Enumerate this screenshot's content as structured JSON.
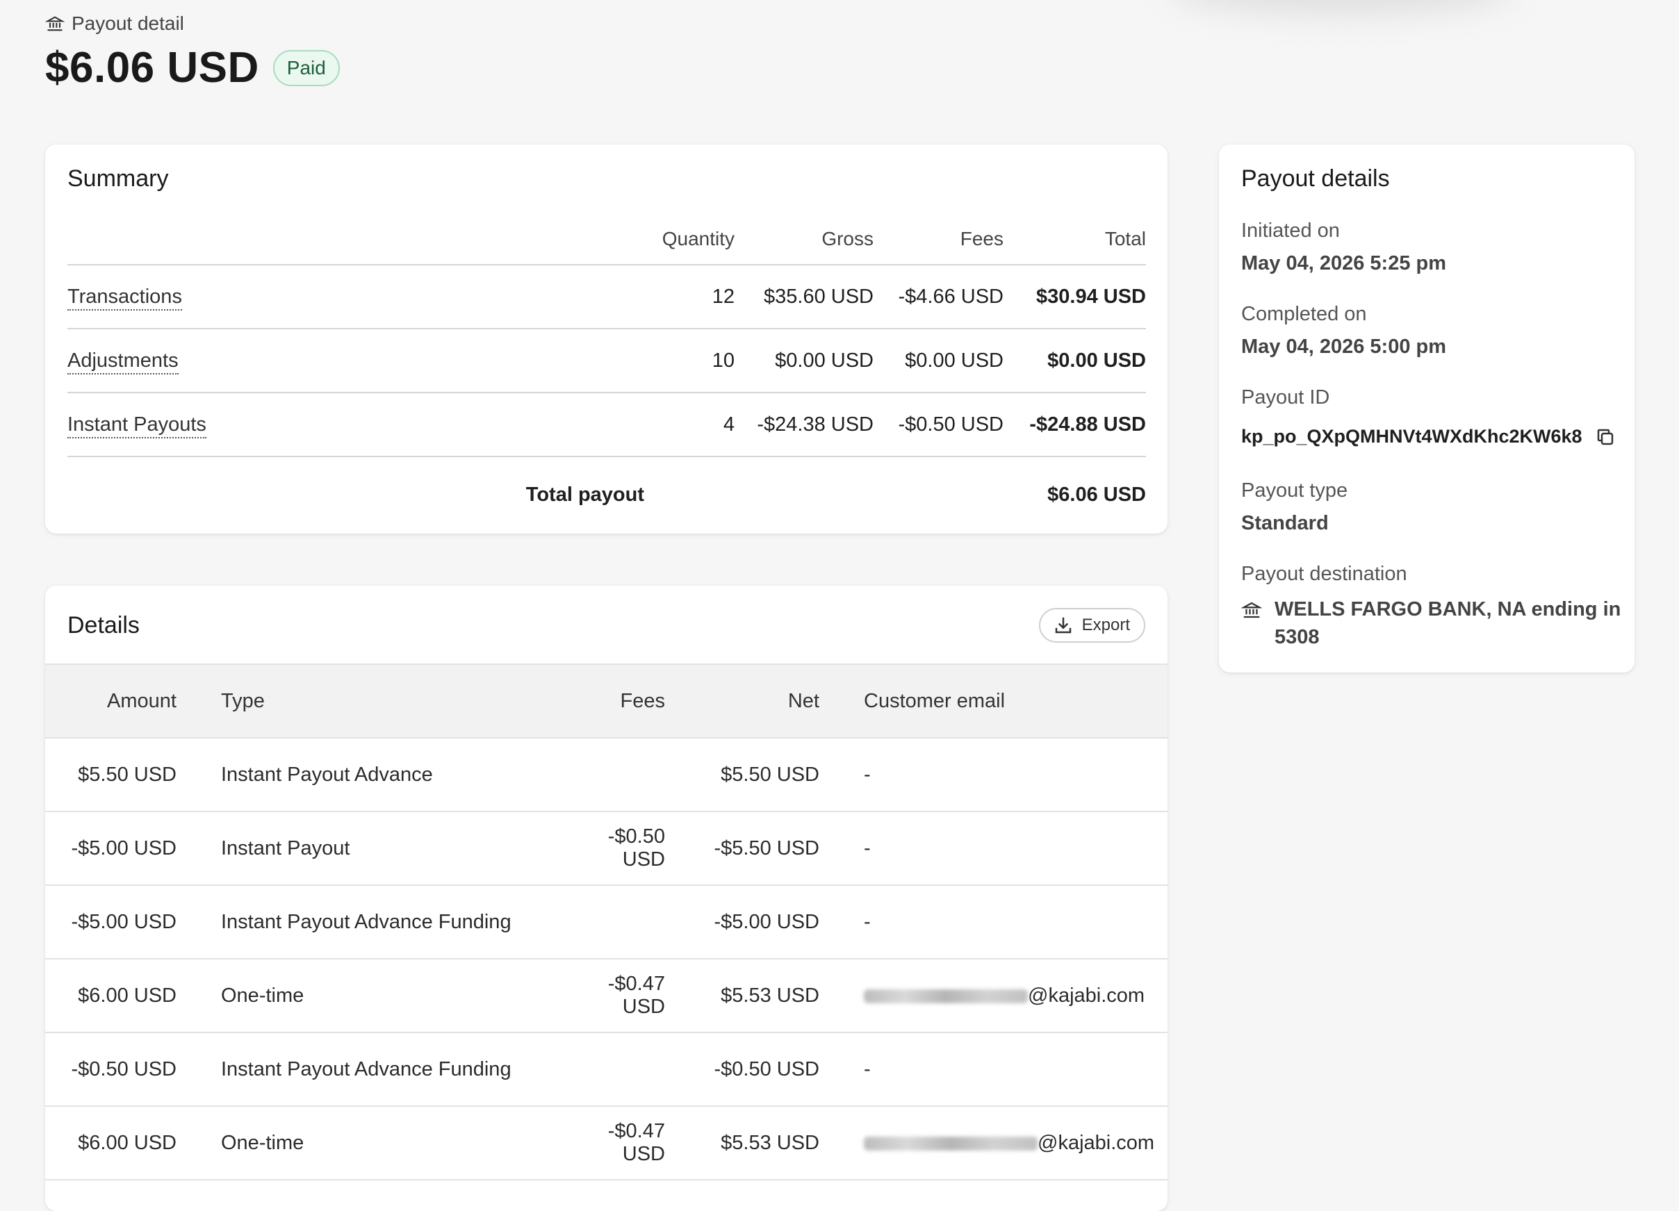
{
  "header": {
    "breadcrumb": "Payout detail",
    "amount": "$6.06 USD",
    "status_badge": "Paid"
  },
  "summary": {
    "title": "Summary",
    "columns": [
      "Quantity",
      "Gross",
      "Fees",
      "Total"
    ],
    "rows": [
      {
        "label": "Transactions",
        "quantity": "12",
        "gross": "$35.60 USD",
        "fees": "-$4.66 USD",
        "total": "$30.94 USD"
      },
      {
        "label": "Adjustments",
        "quantity": "10",
        "gross": "$0.00 USD",
        "fees": "$0.00 USD",
        "total": "$0.00 USD"
      },
      {
        "label": "Instant Payouts",
        "quantity": "4",
        "gross": "-$24.38 USD",
        "fees": "-$0.50 USD",
        "total": "-$24.88 USD"
      }
    ],
    "total_label": "Total payout",
    "total_value": "$6.06 USD"
  },
  "payout_details": {
    "title": "Payout details",
    "initiated_label": "Initiated on",
    "initiated_value": "May 04, 2026 5:25 pm",
    "completed_label": "Completed on",
    "completed_value": "May 04, 2026 5:00 pm",
    "id_label": "Payout ID",
    "id_value": "kp_po_QXpQMHNVt4WXdKhc2KW6k8",
    "type_label": "Payout type",
    "type_value": "Standard",
    "destination_label": "Payout destination",
    "destination_value": "WELLS FARGO BANK, NA ending in 5308"
  },
  "details": {
    "title": "Details",
    "export_label": "Export",
    "columns": {
      "amount": "Amount",
      "type": "Type",
      "fees": "Fees",
      "net": "Net",
      "email": "Customer email"
    },
    "rows": [
      {
        "amount": "$5.50 USD",
        "type": "Instant Payout Advance",
        "fees": "",
        "net": "$5.50 USD",
        "net_negative": false,
        "email": "-",
        "email_redacted": false
      },
      {
        "amount": "-$5.00 USD",
        "type": "Instant Payout",
        "fees": "-$0.50 USD",
        "net": "-$5.50 USD",
        "net_negative": true,
        "email": "-",
        "email_redacted": false
      },
      {
        "amount": "-$5.00 USD",
        "type": "Instant Payout Advance Funding",
        "fees": "",
        "net": "-$5.00 USD",
        "net_negative": true,
        "email": "-",
        "email_redacted": false
      },
      {
        "amount": "$6.00 USD",
        "type": "One-time",
        "fees": "-$0.47 USD",
        "net": "$5.53 USD",
        "net_negative": false,
        "email": "@kajabi.com",
        "email_redacted": true
      },
      {
        "amount": "-$0.50 USD",
        "type": "Instant Payout Advance Funding",
        "fees": "",
        "net": "-$0.50 USD",
        "net_negative": true,
        "email": "-",
        "email_redacted": false
      },
      {
        "amount": "$6.00 USD",
        "type": "One-time",
        "fees": "-$0.47 USD",
        "net": "$5.53 USD",
        "net_negative": false,
        "email": "@kajabi.com",
        "email_redacted": true
      }
    ]
  },
  "colors": {
    "negative": "#c62828",
    "badge_bg": "#ebf8f0",
    "badge_border": "#a9dcbf"
  }
}
